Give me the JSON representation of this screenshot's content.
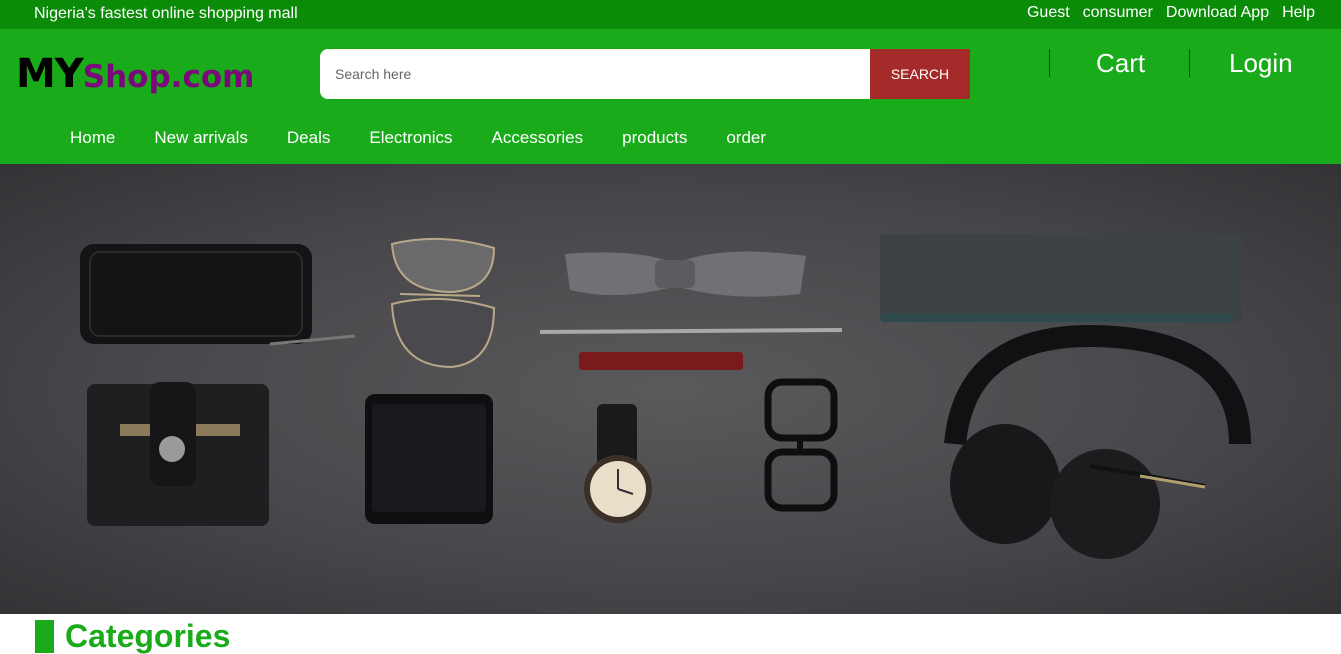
{
  "topbar": {
    "tagline": "Nigeria's fastest online shopping mall",
    "links": [
      "Guest",
      "consumer",
      "Download App",
      "Help"
    ]
  },
  "header": {
    "logo_my": "MY",
    "logo_shop": "Shop.com",
    "search_placeholder": "Search here",
    "search_button": "SEARCH",
    "cart": "Cart",
    "login": "Login"
  },
  "nav": [
    "Home",
    "New arrivals",
    "Deals",
    "Electronics",
    "Accessories",
    "products",
    "order"
  ],
  "hero": {
    "items": [
      "wallet-icon",
      "sunglasses-icon",
      "bow-tie-icon",
      "pen-icon",
      "notebook-icon",
      "card-holder-icon",
      "smartphone-icon",
      "watch-icon",
      "glasses-icon",
      "headphones-icon"
    ]
  },
  "section": {
    "title": "Categories"
  },
  "colors": {
    "topbar": "#0b8c08",
    "header": "#1aab1a",
    "search_button": "#a52a2a",
    "logo_shop": "#7b087b"
  }
}
